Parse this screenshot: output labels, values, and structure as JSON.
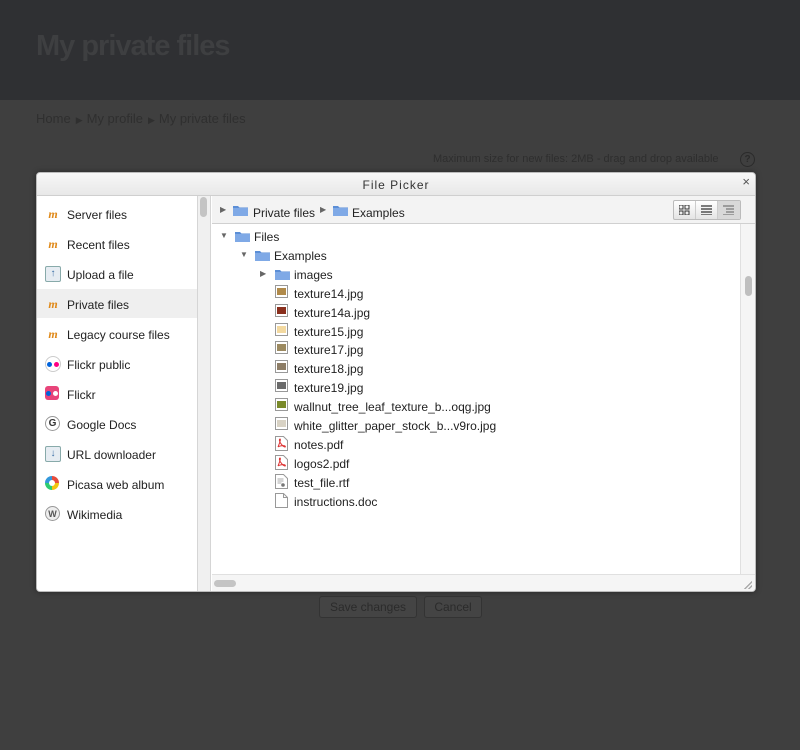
{
  "page": {
    "title": "My private files",
    "breadcrumb": [
      "Home",
      "My profile",
      "My private files"
    ],
    "max_size_text": "Maximum size for new files: 2MB - drag and drop available",
    "help_icon": "?",
    "save_button": "Save changes",
    "cancel_button": "Cancel"
  },
  "dialog": {
    "title": "File Picker",
    "close_glyph": "×",
    "repositories": [
      {
        "label": "Server files",
        "icon": "moodle-icon",
        "glyph": "m"
      },
      {
        "label": "Recent files",
        "icon": "moodle-icon",
        "glyph": "m"
      },
      {
        "label": "Upload a file",
        "icon": "upload-icon",
        "glyph": "↑"
      },
      {
        "label": "Private files",
        "icon": "moodle-icon",
        "glyph": "m",
        "active": true
      },
      {
        "label": "Legacy course files",
        "icon": "moodle-icon",
        "glyph": "m"
      },
      {
        "label": "Flickr public",
        "icon": "flickr-public-icon",
        "glyph": ""
      },
      {
        "label": "Flickr",
        "icon": "flickr-icon",
        "glyph": ""
      },
      {
        "label": "Google Docs",
        "icon": "google-docs-icon",
        "glyph": "G"
      },
      {
        "label": "URL downloader",
        "icon": "url-downloader-icon",
        "glyph": "↓"
      },
      {
        "label": "Picasa web album",
        "icon": "picasa-icon",
        "glyph": ""
      },
      {
        "label": "Wikimedia",
        "icon": "wikimedia-icon",
        "glyph": "W"
      }
    ],
    "path": [
      "Private files",
      "Examples"
    ],
    "view_modes": [
      "icons-view",
      "list-view",
      "tree-view"
    ],
    "active_view": "tree-view",
    "tree": [
      {
        "name": "Files",
        "type": "folder",
        "level": 0,
        "expanded": true
      },
      {
        "name": "Examples",
        "type": "folder",
        "level": 1,
        "expanded": true
      },
      {
        "name": "images",
        "type": "folder",
        "level": 2,
        "expanded": false
      },
      {
        "name": "texture14.jpg",
        "type": "image",
        "level": 2,
        "thumb": "#b08a4a"
      },
      {
        "name": "texture14a.jpg",
        "type": "image",
        "level": 2,
        "thumb": "#8a2f1d"
      },
      {
        "name": "texture15.jpg",
        "type": "image",
        "level": 2,
        "thumb": "#f3d9a0"
      },
      {
        "name": "texture17.jpg",
        "type": "image",
        "level": 2,
        "thumb": "#9c8a60"
      },
      {
        "name": "texture18.jpg",
        "type": "image",
        "level": 2,
        "thumb": "#8d7d66"
      },
      {
        "name": "texture19.jpg",
        "type": "image",
        "level": 2,
        "thumb": "#6b6b6b"
      },
      {
        "name": "wallnut_tree_leaf_texture_b...oqg.jpg",
        "type": "image",
        "level": 2,
        "thumb": "#7a8a2a"
      },
      {
        "name": "white_glitter_paper_stock_b...v9ro.jpg",
        "type": "image",
        "level": 2,
        "thumb": "#d8d2c4"
      },
      {
        "name": "notes.pdf",
        "type": "pdf",
        "level": 2
      },
      {
        "name": "logos2.pdf",
        "type": "pdf",
        "level": 2
      },
      {
        "name": "test_file.rtf",
        "type": "rtf",
        "level": 2
      },
      {
        "name": "instructions.doc",
        "type": "doc",
        "level": 2
      }
    ]
  },
  "colors": {
    "folder": "#5b8ed6",
    "active_repo_bg": "#efefef",
    "pdf": "#d33"
  }
}
